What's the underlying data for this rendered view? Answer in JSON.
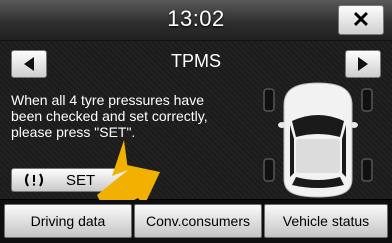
{
  "header": {
    "time": "13:02",
    "close_icon": "close-icon"
  },
  "page": {
    "title": "TPMS",
    "prev_icon": "left-arrow-icon",
    "next_icon": "right-arrow-icon",
    "message": "When all 4 tyre pressures have been checked and set correctly, please press \"SET\".",
    "set_button": {
      "label": "SET",
      "icon": "tpms-warning-icon"
    },
    "vehicle_icon": "car-top-view-icon"
  },
  "tabs": [
    {
      "label": "Driving data"
    },
    {
      "label": "Conv.consumers"
    },
    {
      "label": "Vehicle status"
    }
  ],
  "colors": {
    "arrow": "#f2b000",
    "background": "#000000",
    "tab": "#e6e6e6"
  }
}
